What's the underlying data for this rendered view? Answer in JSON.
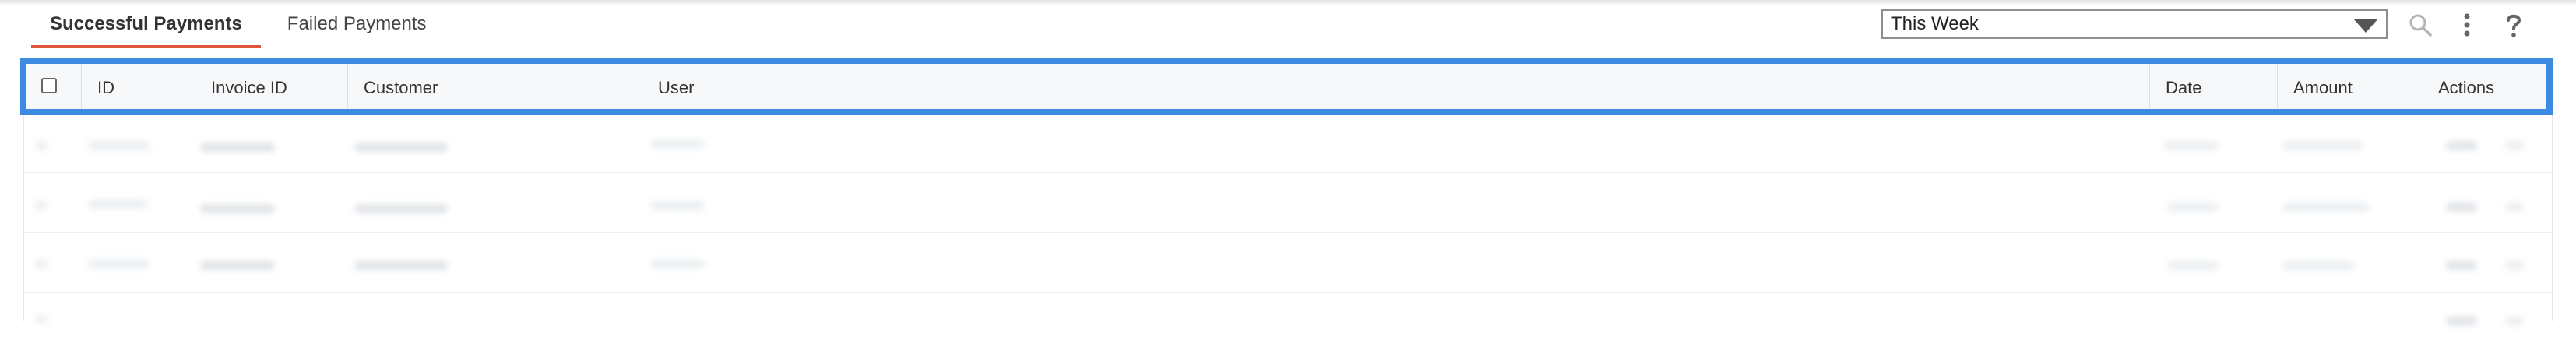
{
  "tabs": [
    {
      "label": "Successful Payments",
      "active": true
    },
    {
      "label": "Failed Payments",
      "active": false
    }
  ],
  "toolbar": {
    "period_value": "This Week",
    "icons": [
      "search-icon",
      "more-vertical-icon",
      "help-icon"
    ]
  },
  "table": {
    "columns": [
      "ID",
      "Invoice ID",
      "Customer",
      "User",
      "Date",
      "Amount",
      "Actions"
    ],
    "select_all_checked": false
  },
  "colors": {
    "active_tab_underline": "#e0563f",
    "highlight_border": "#3d8ae3",
    "header_background": "#f6f8fa"
  }
}
